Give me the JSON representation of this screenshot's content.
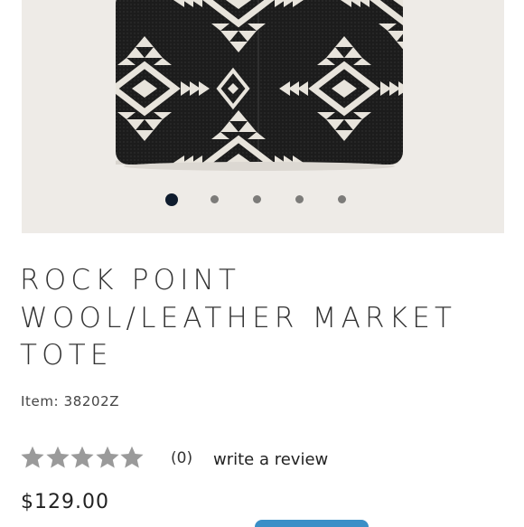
{
  "product": {
    "title": "ROCK POINT WOOL/LEATHER MARKET TOTE",
    "item_number": "Item: 38202Z",
    "price": "$129.00"
  },
  "rating": {
    "stars_filled": 0,
    "stars_total": 5,
    "count": "(0)",
    "write_review": "write a review"
  },
  "carousel": {
    "slides": 5,
    "active_index": 0
  },
  "colors": {
    "star": "#9a9a9a",
    "active_dot": "#0f1c2e",
    "inactive_dot": "#7c7b79",
    "cta": "#3a8fc7"
  }
}
